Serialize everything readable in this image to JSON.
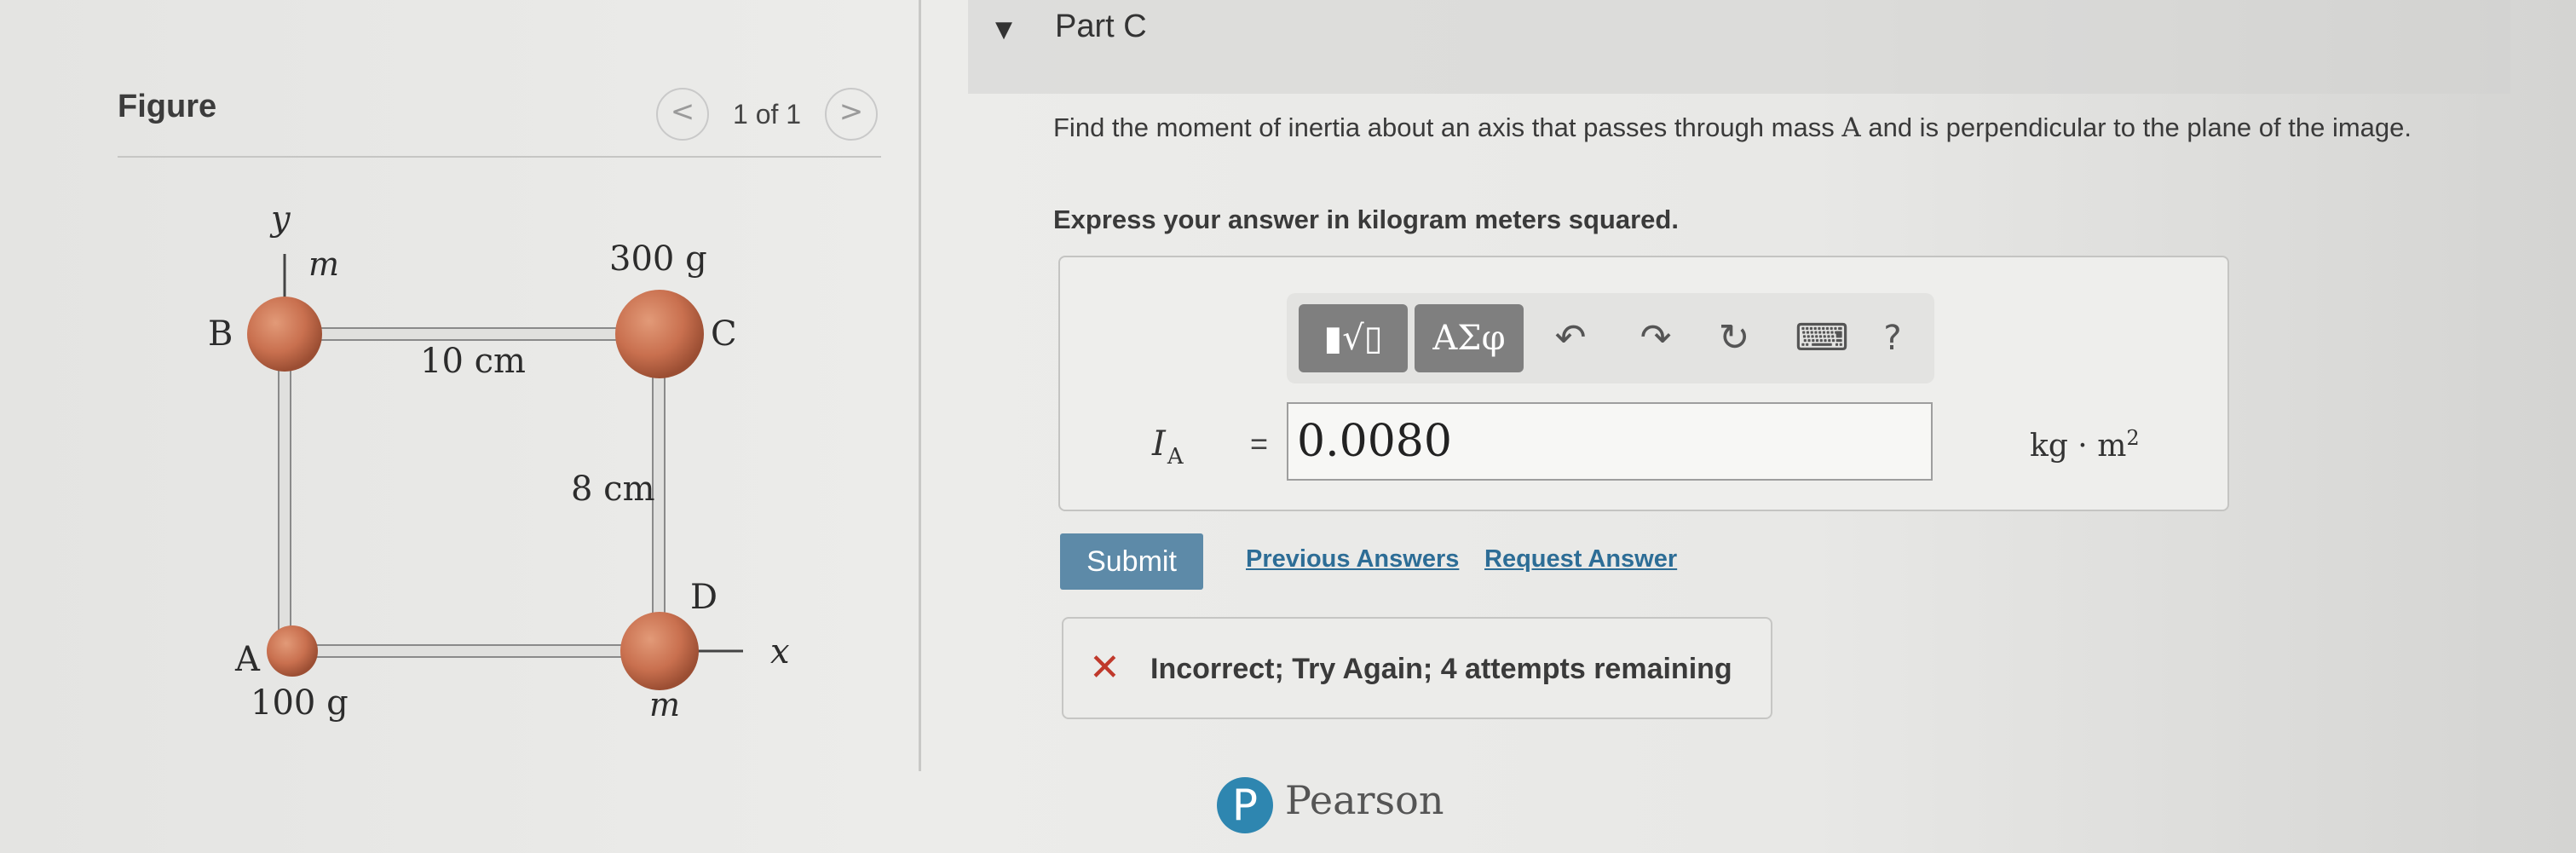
{
  "figure": {
    "title": "Figure",
    "prev_icon": "<",
    "next_icon": ">",
    "page_indicator": "1 of 1",
    "diagram": {
      "y_axis": "y",
      "x_axis": "x",
      "label_B": "B",
      "label_C": "C",
      "label_D": "D",
      "label_A": "A",
      "mass_B": "m",
      "mass_C": "300 g",
      "mass_D": "m",
      "mass_A": "100 g",
      "dim_horizontal": "10 cm",
      "dim_vertical": "8 cm"
    }
  },
  "part": {
    "caret": "▼",
    "title": "Part C"
  },
  "question": {
    "before": "Find the moment of inertia about an axis that passes through mass ",
    "symbol": "A",
    "after": " and is perpendicular to the plane of the image."
  },
  "instruction": "Express your answer in kilogram meters squared.",
  "toolbar": {
    "templates_glyph": "▮√▯",
    "symbols_label": "ΑΣφ",
    "undo_glyph": "↶",
    "redo_glyph": "↷",
    "reset_glyph": "↻",
    "keyboard_glyph": "⌨",
    "help_label": "?"
  },
  "answer": {
    "label": "I",
    "label_sub": "A",
    "equals": "=",
    "value": "0.0080",
    "units": "kg · m",
    "units_exp": "2"
  },
  "actions": {
    "submit": "Submit",
    "previous_answers": "Previous Answers",
    "request_answer": "Request Answer"
  },
  "feedback": {
    "icon": "✕",
    "text": "Incorrect; Try Again; 4 attempts remaining"
  },
  "branding": {
    "logo_letter": "P",
    "name": "Pearson"
  },
  "colors": {
    "submit": "#5d8aa8",
    "link": "#2d6d96",
    "error": "#c0392b",
    "mass": "#c9704f",
    "pearson": "#2e86b0"
  }
}
